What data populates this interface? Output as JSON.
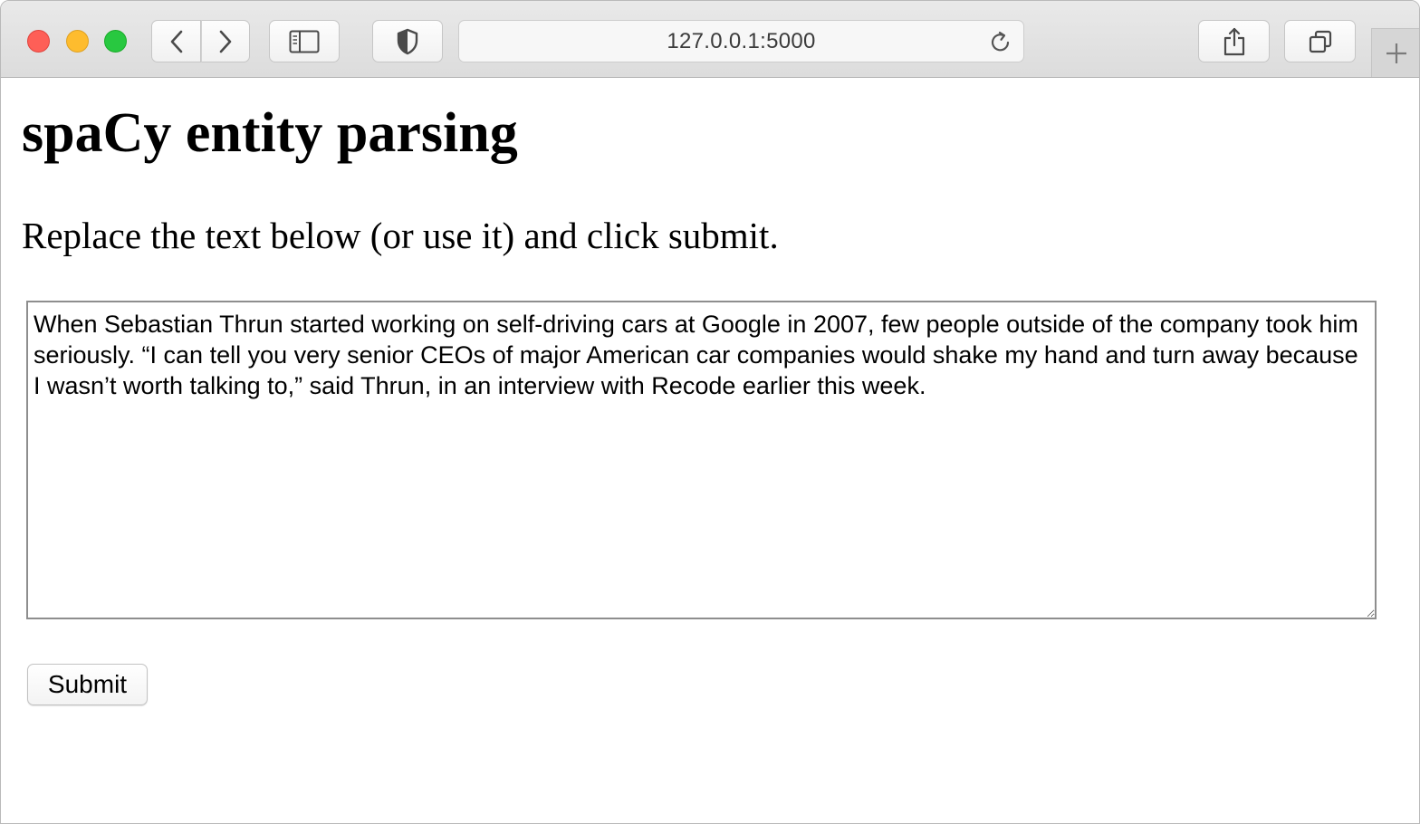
{
  "browser": {
    "url": "127.0.0.1:5000",
    "icons": {
      "back": "chevron-left-icon",
      "forward": "chevron-right-icon",
      "sidebar": "sidebar-icon",
      "privacy": "shield-icon",
      "reload": "reload-icon",
      "share": "share-icon",
      "tabs": "tabs-overview-icon",
      "new_tab": "plus-icon"
    },
    "traffic_light_colors": {
      "close": "#fe5f57",
      "minimize": "#febc2e",
      "zoom": "#28c840"
    }
  },
  "page": {
    "title": "spaCy entity parsing",
    "instructions": "Replace the text below (or use it) and click submit.",
    "textarea_value": "When Sebastian Thrun started working on self-driving cars at Google in 2007, few people outside of the company took him seriously. “I can tell you very senior CEOs of major American car companies would shake my hand and turn away because I wasn’t worth talking to,” said Thrun, in an interview with Recode earlier this week.",
    "submit_label": "Submit"
  }
}
